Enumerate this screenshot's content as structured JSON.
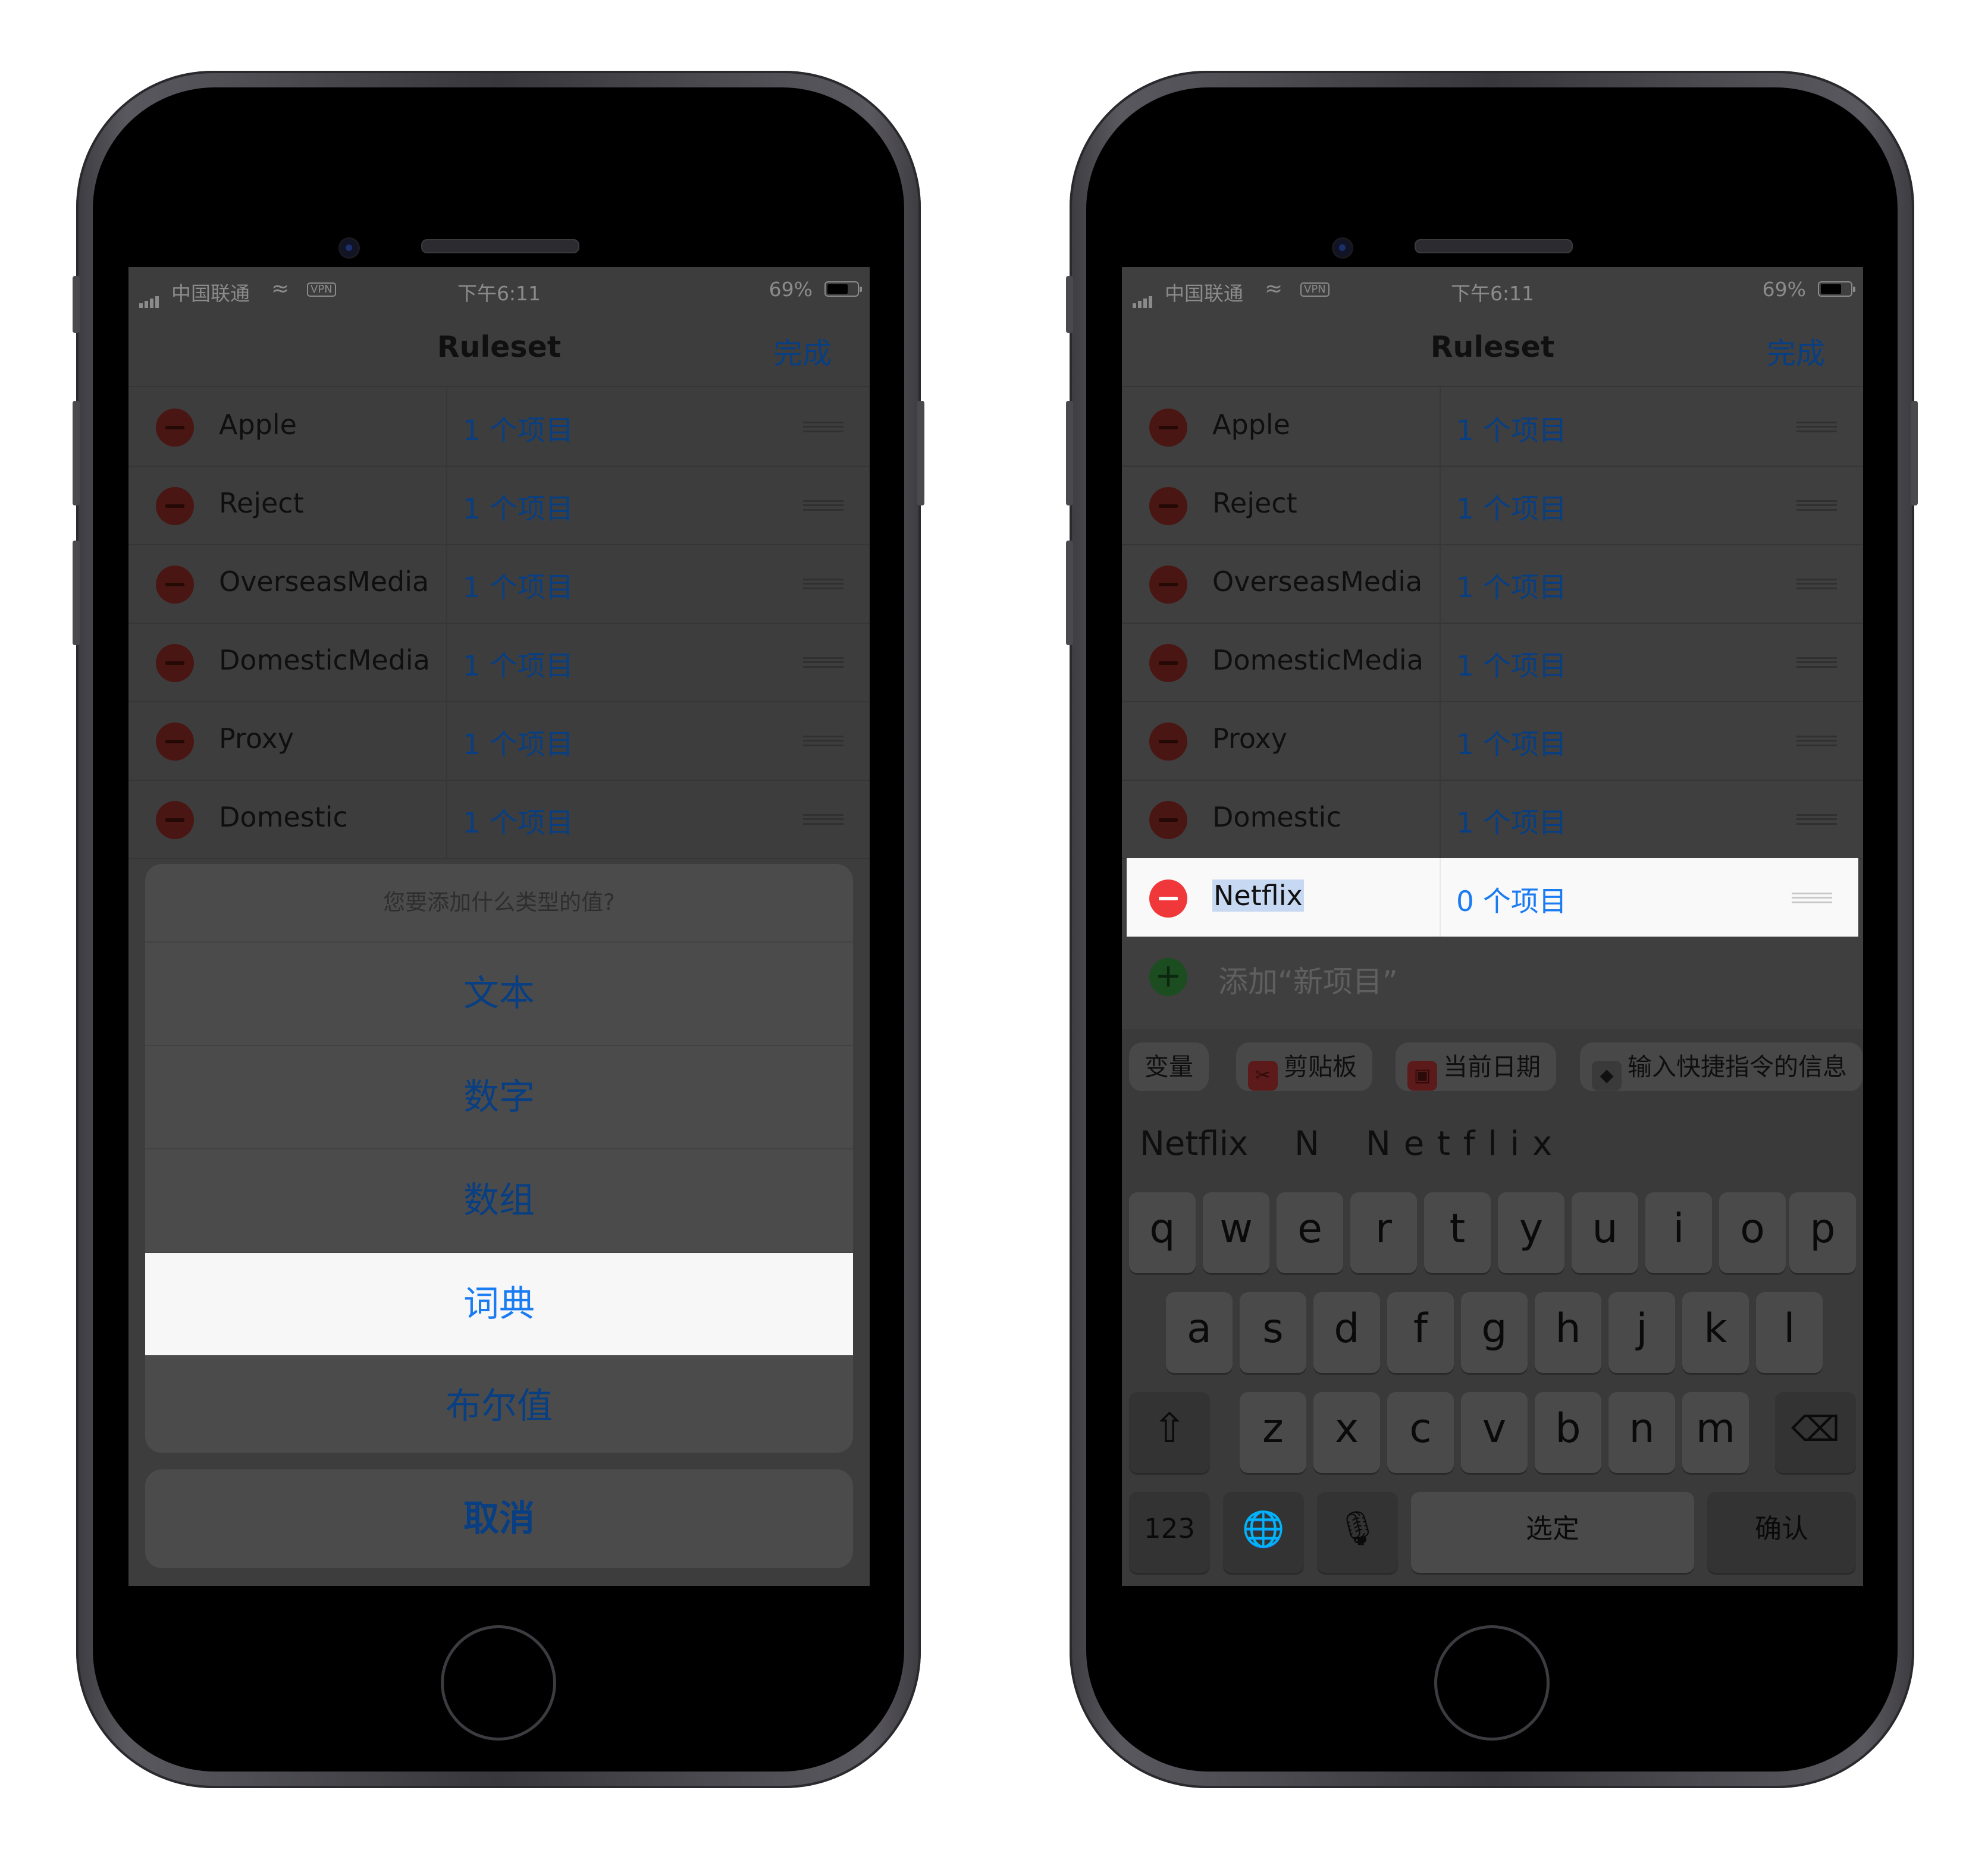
{
  "status": {
    "carrier": "中国联通",
    "vpn": "VPN",
    "time": "下午6:11",
    "battery": "69%"
  },
  "nav": {
    "title": "Ruleset",
    "done": "完成"
  },
  "rows": [
    {
      "name": "Apple",
      "value": "1 个项目"
    },
    {
      "name": "Reject",
      "value": "1 个项目"
    },
    {
      "name": "OverseasMedia",
      "value": "1 个项目"
    },
    {
      "name": "DomesticMedia",
      "value": "1 个项目"
    },
    {
      "name": "Proxy",
      "value": "1 个项目"
    },
    {
      "name": "Domestic",
      "value": "1 个项目"
    }
  ],
  "left_phone": {
    "action_sheet": {
      "question": "您要添加什么类型的值?",
      "options": [
        "文本",
        "数字",
        "数组",
        "词典",
        "布尔值"
      ],
      "highlighted": "词典",
      "cancel": "取消"
    }
  },
  "right_phone": {
    "new_row": {
      "name": "Netflix",
      "value": "0 个项目"
    },
    "add_label": "添加“新项目”",
    "variable_bar": {
      "label": "变量",
      "chips": [
        {
          "label": "剪贴板",
          "icon": "scissors-icon",
          "color": "#5c1a1a"
        },
        {
          "label": "当前日期",
          "icon": "calendar-icon",
          "color": "#5c1a1a"
        },
        {
          "label": "输入快捷指令的信息",
          "icon": "shortcuts-icon",
          "color": "#1a1a1a"
        }
      ]
    },
    "suggestions": [
      "Netflix",
      "N",
      "N e t f l i x"
    ],
    "keyboard": {
      "row1": [
        "q",
        "w",
        "e",
        "r",
        "t",
        "y",
        "u",
        "i",
        "o",
        "p"
      ],
      "row2": [
        "a",
        "s",
        "d",
        "f",
        "g",
        "h",
        "j",
        "k",
        "l"
      ],
      "row3": [
        "z",
        "x",
        "c",
        "v",
        "b",
        "n",
        "m"
      ],
      "num": "123",
      "space": "选定",
      "return": "确认"
    }
  },
  "colors": {
    "accent": "#1a7cf2",
    "delete": "#f0383a",
    "add": "#34c759"
  }
}
